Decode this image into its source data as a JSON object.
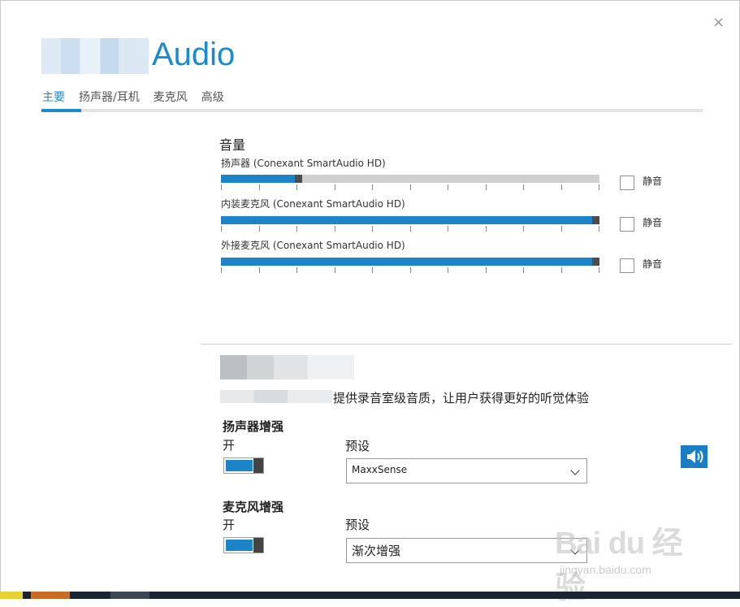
{
  "header": {
    "brand": "Audio",
    "close_glyph": "×"
  },
  "tabs": [
    {
      "label": "主要",
      "active": true
    },
    {
      "label": "扬声器/耳机",
      "active": false
    },
    {
      "label": "麦克风",
      "active": false
    },
    {
      "label": "高级",
      "active": false
    }
  ],
  "volume": {
    "title": "音量",
    "devices": [
      {
        "label": "扬声器 (Conexant SmartAudio HD)",
        "level_fraction": 0.2,
        "mute_label": "静音",
        "muted": false
      },
      {
        "label": "内装麦克风 (Conexant SmartAudio HD)",
        "level_fraction": 1.0,
        "mute_label": "静音",
        "muted": false
      },
      {
        "label": "外接麦克风 (Conexant SmartAudio HD)",
        "level_fraction": 1.0,
        "mute_label": "静音",
        "muted": false
      }
    ]
  },
  "enhance": {
    "description": "提供录音室级音质，让用户获得更好的听觉体验",
    "speaker": {
      "title": "扬声器增强",
      "state_label": "开",
      "preset_label": "预设",
      "preset_value": "MaxxSense"
    },
    "mic": {
      "title": "麦克风增强",
      "state_label": "开",
      "preset_label": "预设",
      "preset_value": "渐次增强"
    }
  },
  "watermark": {
    "text": "Bai du 经验",
    "url": "jingyan.baidu.com"
  },
  "colors": {
    "accent": "#1b8bd0",
    "fill": "#1b85c8",
    "thumb": "#4d4d4d"
  }
}
